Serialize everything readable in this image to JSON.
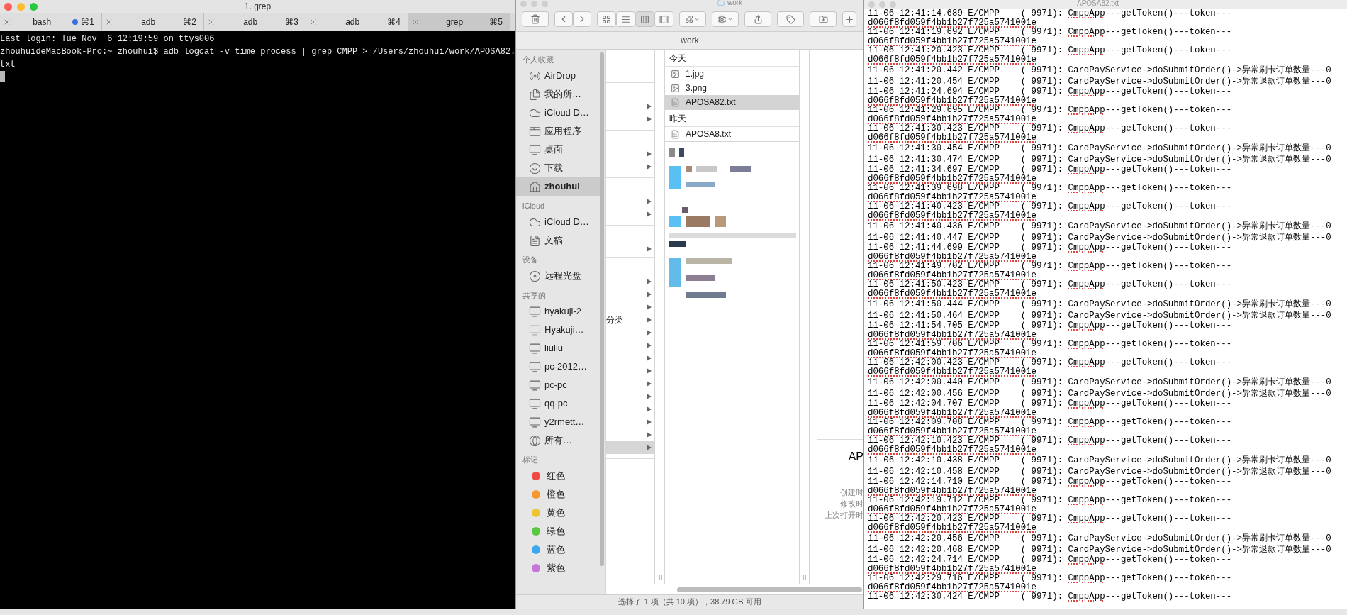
{
  "terminal": {
    "title": "1. grep",
    "tabs": [
      {
        "label": "bash",
        "shortcut": "⌘1",
        "activity": true,
        "selected": false
      },
      {
        "label": "adb",
        "shortcut": "⌘2",
        "activity": false,
        "selected": false
      },
      {
        "label": "adb",
        "shortcut": "⌘3",
        "activity": false,
        "selected": false
      },
      {
        "label": "adb",
        "shortcut": "⌘4",
        "activity": false,
        "selected": false
      },
      {
        "label": "grep",
        "shortcut": "⌘5",
        "activity": false,
        "selected": true
      }
    ],
    "lines": [
      "Last login: Tue Nov  6 12:19:59 on ttys006",
      "zhouhuideMacBook-Pro:~ zhouhui$ adb logcat -v time process | grep CMPP > /Users/zhouhui/work/APOSA82.",
      "txt"
    ]
  },
  "finder": {
    "title": "work",
    "path_title": "work",
    "view_modes": [
      {
        "kind": "icons",
        "selected": false
      },
      {
        "kind": "list",
        "selected": false
      },
      {
        "kind": "columns",
        "selected": true
      },
      {
        "kind": "gallery",
        "selected": false
      }
    ],
    "sidebar": [
      {
        "heading": "个人收藏",
        "items": [
          {
            "label": "AirDrop",
            "kind": "airdrop",
            "selected": false
          },
          {
            "label": "我的所…",
            "kind": "allfiles",
            "selected": false
          },
          {
            "label": "iCloud D…",
            "kind": "cloud",
            "selected": false
          },
          {
            "label": "应用程序",
            "kind": "apps",
            "selected": false
          },
          {
            "label": "桌面",
            "kind": "desktop",
            "selected": false
          },
          {
            "label": "下载",
            "kind": "downloads",
            "selected": false
          },
          {
            "label": "zhouhui",
            "kind": "home",
            "selected": true
          }
        ]
      },
      {
        "heading": "iCloud",
        "items": [
          {
            "label": "iCloud D…",
            "kind": "cloud",
            "selected": false
          },
          {
            "label": "文稿",
            "kind": "documents",
            "selected": false
          }
        ]
      },
      {
        "heading": "设备",
        "items": [
          {
            "label": "远程光盘",
            "kind": "disc",
            "selected": false
          }
        ]
      },
      {
        "heading": "共享的",
        "items": [
          {
            "label": "hyakuji-2",
            "kind": "computer",
            "selected": false
          },
          {
            "label": "Hyakuji…",
            "kind": "display",
            "selected": false
          },
          {
            "label": "liuliu",
            "kind": "computer",
            "selected": false
          },
          {
            "label": "pc-2012…",
            "kind": "computer",
            "selected": false
          },
          {
            "label": "pc-pc",
            "kind": "computer",
            "selected": false
          },
          {
            "label": "qq-pc",
            "kind": "computer",
            "selected": false
          },
          {
            "label": "y2rmett…",
            "kind": "computer",
            "selected": false
          },
          {
            "label": "所有…",
            "kind": "network",
            "selected": false
          }
        ]
      }
    ],
    "tags": {
      "heading": "标记",
      "items": [
        {
          "label": "红色",
          "color": "#f04a45"
        },
        {
          "label": "橙色",
          "color": "#f5962e"
        },
        {
          "label": "黄色",
          "color": "#edc431"
        },
        {
          "label": "绿色",
          "color": "#5ac83f"
        },
        {
          "label": "蓝色",
          "color": "#39a8ef"
        },
        {
          "label": "紫色",
          "color": "#c676d8"
        }
      ]
    },
    "column_1": {
      "groups": [
        {
          "rows": [
            {
              "selected": false
            },
            {
              "selected": false
            }
          ]
        },
        {
          "rows": [
            {
              "selected": false
            },
            {
              "selected": false
            }
          ]
        },
        {
          "rows": [
            {
              "selected": false
            },
            {
              "selected": false
            }
          ]
        },
        {
          "rows": [
            {
              "selected": false
            }
          ]
        },
        {
          "rows": [
            {
              "selected": false
            },
            {
              "selected": false
            },
            {
              "selected": false
            },
            {
              "label": "分类",
              "selected": false
            },
            {
              "selected": false
            },
            {
              "selected": false
            },
            {
              "selected": false
            },
            {
              "selected": false
            },
            {
              "selected": false
            },
            {
              "selected": false
            },
            {
              "selected": false
            },
            {
              "selected": false
            },
            {
              "selected": false
            },
            {
              "selected": true
            }
          ]
        }
      ]
    },
    "column_2": {
      "groups": [
        {
          "heading": "今天",
          "files": [
            {
              "name": "1.jpg",
              "kind": "image",
              "selected": false
            },
            {
              "name": "3.png",
              "kind": "image",
              "selected": false
            },
            {
              "name": "APOSA82.txt",
              "kind": "text",
              "selected": true
            }
          ]
        },
        {
          "heading": "昨天",
          "files": [
            {
              "name": "APOSA8.txt",
              "kind": "text",
              "selected": false
            }
          ]
        }
      ]
    },
    "preview": {
      "name": "AP",
      "labels": [
        "创建时",
        "修改时",
        "上次打开时"
      ]
    },
    "status_bar": "选择了 1 项（共 10 项），38.79 GB 可用"
  },
  "editor": {
    "title": "APOSA82.txt",
    "entries": [
      {
        "kind": "token",
        "header": "11-06 12:41:14.689 E/CMPP    ( 9971): ",
        "flagged": "CmppApp",
        "message": "---getToken()---token---",
        "continuation": "d066f8fd059f4bb1b27f725a5741001e"
      },
      {
        "kind": "token",
        "header": "11-06 12:41:19.692 E/CMPP    ( 9971): ",
        "flagged": "CmppApp",
        "message": "---getToken()---token---",
        "continuation": "d066f8fd059f4bb1b27f725a5741001e"
      },
      {
        "kind": "token",
        "header": "11-06 12:41:20.423 E/CMPP    ( 9971): ",
        "flagged": "CmppApp",
        "message": "---getToken()---token---",
        "continuation": "d066f8fd059f4bb1b27f725a5741001e"
      },
      {
        "kind": "order",
        "header": "11-06 12:41:20.442 E/CMPP    ( 9971): ",
        "message": "CardPayService->doSubmitOrder()->异常刷卡订单数量---0"
      },
      {
        "kind": "order",
        "header": "11-06 12:41:20.454 E/CMPP    ( 9971): ",
        "message": "CardPayService->doSubmitOrder()->异常退款订单数量---0"
      },
      {
        "kind": "token",
        "header": "11-06 12:41:24.694 E/CMPP    ( 9971): ",
        "flagged": "CmppApp",
        "message": "---getToken()---token---",
        "continuation": "d066f8fd059f4bb1b27f725a5741001e"
      },
      {
        "kind": "token",
        "header": "11-06 12:41:29.695 E/CMPP    ( 9971): ",
        "flagged": "CmppApp",
        "message": "---getToken()---token---",
        "continuation": "d066f8fd059f4bb1b27f725a5741001e"
      },
      {
        "kind": "token",
        "header": "11-06 12:41:30.423 E/CMPP    ( 9971): ",
        "flagged": "CmppApp",
        "message": "---getToken()---token---",
        "continuation": "d066f8fd059f4bb1b27f725a5741001e"
      },
      {
        "kind": "order",
        "header": "11-06 12:41:30.454 E/CMPP    ( 9971): ",
        "message": "CardPayService->doSubmitOrder()->异常刷卡订单数量---0"
      },
      {
        "kind": "order",
        "header": "11-06 12:41:30.474 E/CMPP    ( 9971): ",
        "message": "CardPayService->doSubmitOrder()->异常退款订单数量---0"
      },
      {
        "kind": "token",
        "header": "11-06 12:41:34.697 E/CMPP    ( 9971): ",
        "flagged": "CmppApp",
        "message": "---getToken()---token---",
        "continuation": "d066f8fd059f4bb1b27f725a5741001e"
      },
      {
        "kind": "token",
        "header": "11-06 12:41:39.698 E/CMPP    ( 9971): ",
        "flagged": "CmppApp",
        "message": "---getToken()---token---",
        "continuation": "d066f8fd059f4bb1b27f725a5741001e"
      },
      {
        "kind": "token",
        "header": "11-06 12:41:40.423 E/CMPP    ( 9971): ",
        "flagged": "CmppApp",
        "message": "---getToken()---token---",
        "continuation": "d066f8fd059f4bb1b27f725a5741001e"
      },
      {
        "kind": "order",
        "header": "11-06 12:41:40.436 E/CMPP    ( 9971): ",
        "message": "CardPayService->doSubmitOrder()->异常刷卡订单数量---0"
      },
      {
        "kind": "order",
        "header": "11-06 12:41:40.447 E/CMPP    ( 9971): ",
        "message": "CardPayService->doSubmitOrder()->异常退款订单数量---0"
      },
      {
        "kind": "token",
        "header": "11-06 12:41:44.699 E/CMPP    ( 9971): ",
        "flagged": "CmppApp",
        "message": "---getToken()---token---",
        "continuation": "d066f8fd059f4bb1b27f725a5741001e"
      },
      {
        "kind": "token",
        "header": "11-06 12:41:49.702 E/CMPP    ( 9971): ",
        "flagged": "CmppApp",
        "message": "---getToken()---token---",
        "continuation": "d066f8fd059f4bb1b27f725a5741001e"
      },
      {
        "kind": "token",
        "header": "11-06 12:41:50.423 E/CMPP    ( 9971): ",
        "flagged": "CmppApp",
        "message": "---getToken()---token---",
        "continuation": "d066f8fd059f4bb1b27f725a5741001e"
      },
      {
        "kind": "order",
        "header": "11-06 12:41:50.444 E/CMPP    ( 9971): ",
        "message": "CardPayService->doSubmitOrder()->异常刷卡订单数量---0"
      },
      {
        "kind": "order",
        "header": "11-06 12:41:50.464 E/CMPP    ( 9971): ",
        "message": "CardPayService->doSubmitOrder()->异常退款订单数量---0"
      },
      {
        "kind": "token",
        "header": "11-06 12:41:54.705 E/CMPP    ( 9971): ",
        "flagged": "CmppApp",
        "message": "---getToken()---token---",
        "continuation": "d066f8fd059f4bb1b27f725a5741001e"
      },
      {
        "kind": "token",
        "header": "11-06 12:41:59.706 E/CMPP    ( 9971): ",
        "flagged": "CmppApp",
        "message": "---getToken()---token---",
        "continuation": "d066f8fd059f4bb1b27f725a5741001e"
      },
      {
        "kind": "token",
        "header": "11-06 12:42:00.423 E/CMPP    ( 9971): ",
        "flagged": "CmppApp",
        "message": "---getToken()---token---",
        "continuation": "d066f8fd059f4bb1b27f725a5741001e"
      },
      {
        "kind": "order",
        "header": "11-06 12:42:00.440 E/CMPP    ( 9971): ",
        "message": "CardPayService->doSubmitOrder()->异常刷卡订单数量---0"
      },
      {
        "kind": "order",
        "header": "11-06 12:42:00.456 E/CMPP    ( 9971): ",
        "message": "CardPayService->doSubmitOrder()->异常退款订单数量---0"
      },
      {
        "kind": "token",
        "header": "11-06 12:42:04.707 E/CMPP    ( 9971): ",
        "flagged": "CmppApp",
        "message": "---getToken()---token---",
        "continuation": "d066f8fd059f4bb1b27f725a5741001e"
      },
      {
        "kind": "token",
        "header": "11-06 12:42:09.708 E/CMPP    ( 9971): ",
        "flagged": "CmppApp",
        "message": "---getToken()---token---",
        "continuation": "d066f8fd059f4bb1b27f725a5741001e"
      },
      {
        "kind": "token",
        "header": "11-06 12:42:10.423 E/CMPP    ( 9971): ",
        "flagged": "CmppApp",
        "message": "---getToken()---token---",
        "continuation": "d066f8fd059f4bb1b27f725a5741001e"
      },
      {
        "kind": "order",
        "header": "11-06 12:42:10.438 E/CMPP    ( 9971): ",
        "message": "CardPayService->doSubmitOrder()->异常刷卡订单数量---0"
      },
      {
        "kind": "order",
        "header": "11-06 12:42:10.458 E/CMPP    ( 9971): ",
        "message": "CardPayService->doSubmitOrder()->异常退款订单数量---0"
      },
      {
        "kind": "token",
        "header": "11-06 12:42:14.710 E/CMPP    ( 9971): ",
        "flagged": "CmppApp",
        "message": "---getToken()---token---",
        "continuation": "d066f8fd059f4bb1b27f725a5741001e"
      },
      {
        "kind": "token",
        "header": "11-06 12:42:19.712 E/CMPP    ( 9971): ",
        "flagged": "CmppApp",
        "message": "---getToken()---token---",
        "continuation": "d066f8fd059f4bb1b27f725a5741001e"
      },
      {
        "kind": "token",
        "header": "11-06 12:42:20.423 E/CMPP    ( 9971): ",
        "flagged": "CmppApp",
        "message": "---getToken()---token---",
        "continuation": "d066f8fd059f4bb1b27f725a5741001e"
      },
      {
        "kind": "order",
        "header": "11-06 12:42:20.456 E/CMPP    ( 9971): ",
        "message": "CardPayService->doSubmitOrder()->异常刷卡订单数量---0"
      },
      {
        "kind": "order",
        "header": "11-06 12:42:20.468 E/CMPP    ( 9971): ",
        "message": "CardPayService->doSubmitOrder()->异常退款订单数量---0"
      },
      {
        "kind": "token",
        "header": "11-06 12:42:24.714 E/CMPP    ( 9971): ",
        "flagged": "CmppApp",
        "message": "---getToken()---token---",
        "continuation": "d066f8fd059f4bb1b27f725a5741001e"
      },
      {
        "kind": "token",
        "header": "11-06 12:42:29.716 E/CMPP    ( 9971): ",
        "flagged": "CmppApp",
        "message": "---getToken()---token---",
        "continuation": "d066f8fd059f4bb1b27f725a5741001e"
      },
      {
        "kind": "token",
        "header": "11-06 12:42:30.424 E/CMPP    ( 9971): ",
        "flagged": "CmppApp",
        "message": "---getToken()---token---"
      }
    ]
  }
}
